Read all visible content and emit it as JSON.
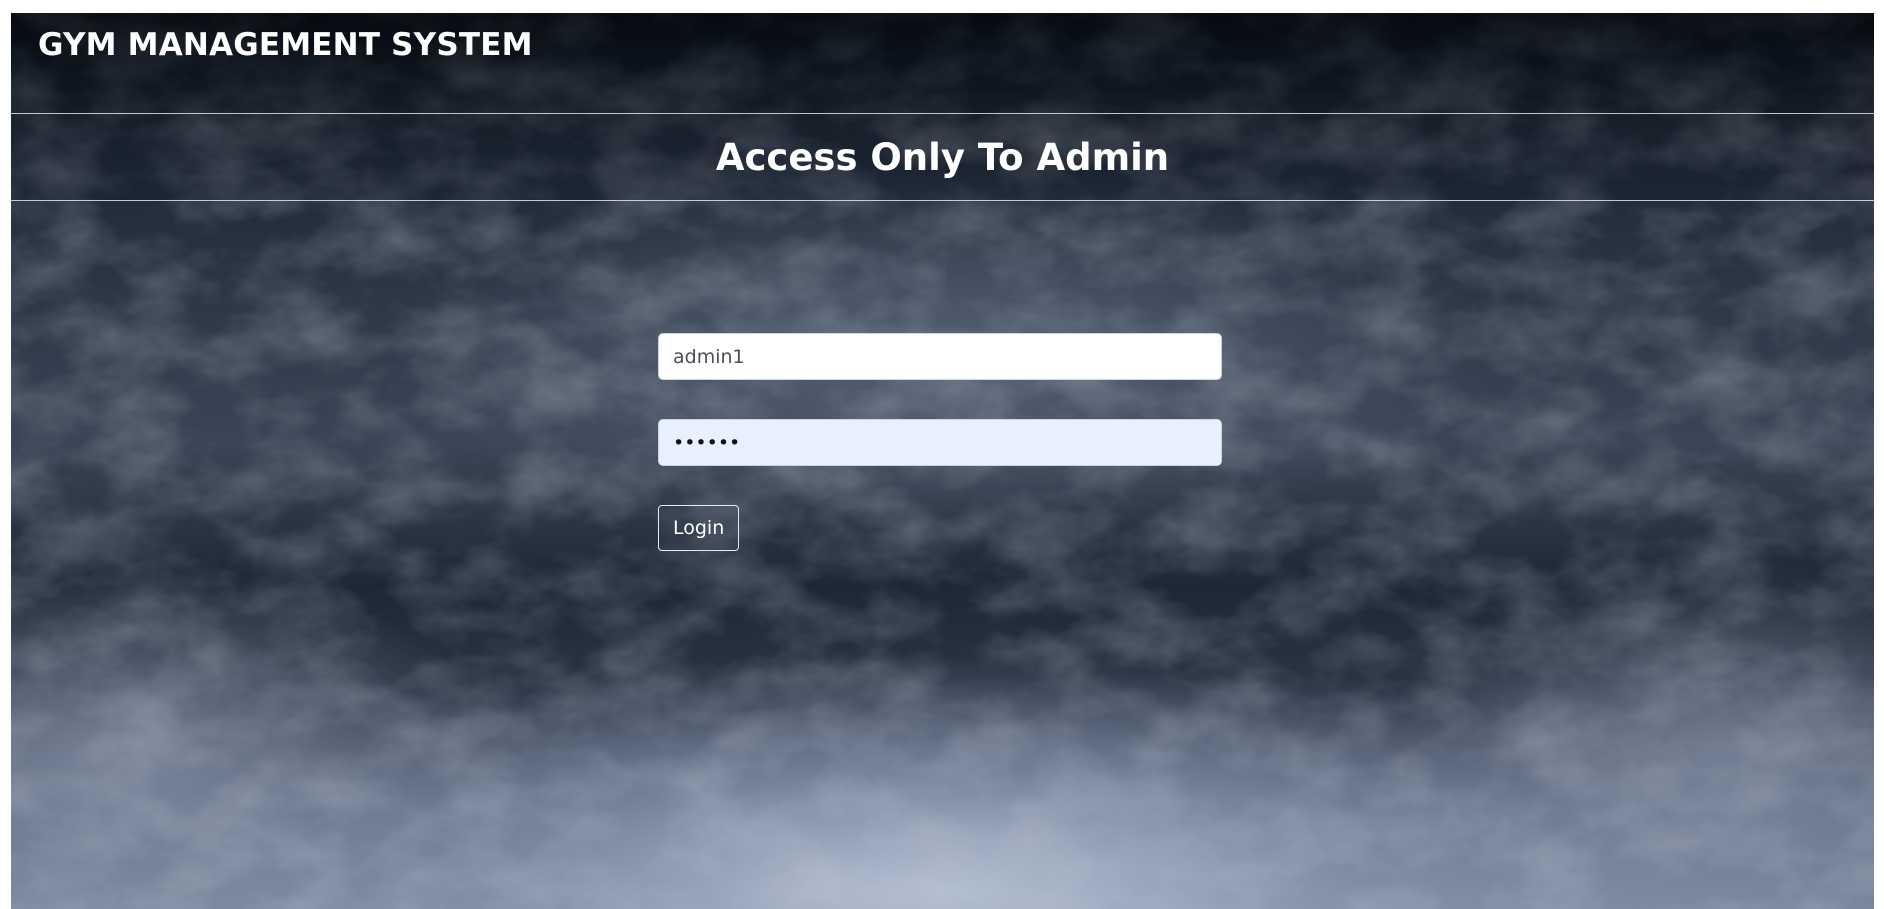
{
  "navbar": {
    "brand": "GYM MANAGEMENT SYSTEM"
  },
  "banner": {
    "title": "Access Only To Admin"
  },
  "login_form": {
    "username_value": "admin1",
    "password_value": "••••••",
    "login_label": "Login"
  },
  "colors": {
    "background_dark": "#1e2734",
    "text": "#ffffff",
    "autofill_bg": "#e8f0fe"
  }
}
